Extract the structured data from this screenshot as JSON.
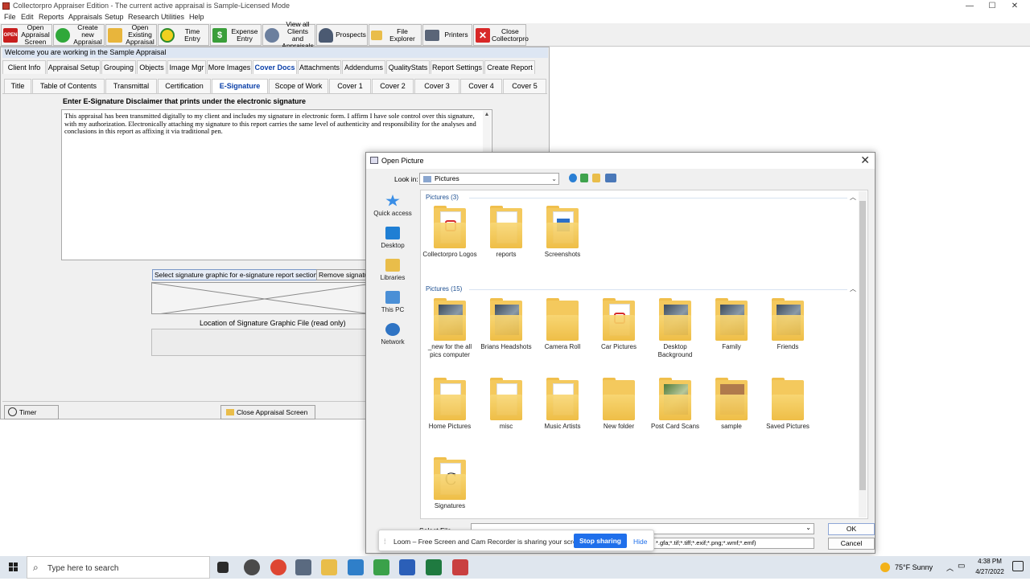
{
  "window": {
    "title": "Collectorpro Appraiser Edition  - The current active appraisal is Sample-Licensed Mode",
    "controls": [
      "—",
      "☐",
      "✕"
    ]
  },
  "menu": [
    "File",
    "Edit",
    "Reports",
    "Appraisals",
    "Setup",
    "Research",
    "Utilities",
    "Help"
  ],
  "toolbar": {
    "buttons": [
      {
        "label": "Open\nAppraisal\nScreen",
        "icon": "open-icon"
      },
      {
        "label": "Create new\nAppraisal",
        "icon": "add-icon"
      },
      {
        "label": "Open\nExisting\nAppraisal",
        "icon": "folder-open-icon"
      },
      {
        "label": "Time Entry",
        "icon": "clock-icon"
      },
      {
        "label": "Expense\nEntry",
        "icon": "dollar-icon"
      },
      {
        "label": "View all\nClients and\nAppraisals",
        "icon": "people-icon"
      },
      {
        "label": "Prospects",
        "icon": "person-icon"
      },
      {
        "label": "File Explorer",
        "icon": "folder-icon"
      },
      {
        "label": "Printers",
        "icon": "printer-icon"
      },
      {
        "label": "Close\nCollectorpro",
        "icon": "close-icon"
      }
    ]
  },
  "welcome": "Welcome  you are working in the  Sample Appraisal",
  "tabs_main": [
    "Client Info",
    "Appraisal Setup",
    "Grouping",
    "Objects",
    "Image Mgr",
    "More Images",
    "Cover Docs",
    "Attachments",
    "Addendums",
    "QualityStats",
    "Report Settings",
    "Create Report"
  ],
  "tabs_main_active": "Cover Docs",
  "tabs_sub": [
    "Title",
    "Table of Contents",
    "Transmittal",
    "Certification",
    "E-Signature",
    "Scope of Work",
    "Cover 1",
    "Cover 2",
    "Cover 3",
    "Cover 4",
    "Cover 5"
  ],
  "tabs_sub_active": "E-Signature",
  "esig": {
    "heading": "Enter E-Signature Disclaimer that prints under the electronic signature",
    "disclaimer": "This appraisal has been transmitted digitally to my client and includes my signature in electronic form. I affirm I have sole control over this signature, with my authorization.  Electronically attaching my signature to this report carries the same level of authenticity and responsibility for the analyses and conclusions in this report as affixing it via traditional pen.",
    "select_button": "Select signature graphic for e-signature report section",
    "remove_button": "Remove signatu",
    "location_label": "Location of Signature Graphic File (read only)"
  },
  "bottom": {
    "timer": "Timer",
    "close_screen": "Close Appraisal  Screen"
  },
  "dialog": {
    "title": "Open Picture",
    "lookin_label": "Look in:",
    "lookin_value": "Pictures",
    "places": [
      "Quick access",
      "Desktop",
      "Libraries",
      "This PC",
      "Network"
    ],
    "group1": "Pictures (3)",
    "group2": "Pictures (15)",
    "items1": [
      {
        "name": "Collectorpro Logos",
        "kind": "pdf"
      },
      {
        "name": "reports",
        "kind": "paper"
      },
      {
        "name": "Screenshots",
        "kind": "blue"
      }
    ],
    "items2": [
      {
        "name": "_new for the all pics computer",
        "kind": "photo"
      },
      {
        "name": "Brians Headshots",
        "kind": "photo"
      },
      {
        "name": "Camera Roll",
        "kind": "empty"
      },
      {
        "name": "Car Pictures",
        "kind": "pdf"
      },
      {
        "name": "Desktop Background",
        "kind": "photo"
      },
      {
        "name": "Family",
        "kind": "photo"
      },
      {
        "name": "Friends",
        "kind": "photo"
      },
      {
        "name": "Home Pictures",
        "kind": "paper"
      },
      {
        "name": "misc",
        "kind": "paper"
      },
      {
        "name": "Music Artists",
        "kind": "paper"
      },
      {
        "name": "New folder",
        "kind": "empty"
      },
      {
        "name": "Post Card Scans",
        "kind": "green"
      },
      {
        "name": "sample",
        "kind": "brown"
      },
      {
        "name": "Saved Pictures",
        "kind": "empty"
      },
      {
        "name": "Signatures",
        "kind": "sig"
      }
    ],
    "select_file_label": "Select File",
    "filter_value": "*.gfa;*.tif;*.tiff;*.exif;*.png;*.wmf;*.emf)",
    "ok": "OK",
    "cancel": "Cancel"
  },
  "loom": {
    "message": "Loom – Free Screen and Cam Recorder is sharing your screen.",
    "stop": "Stop sharing",
    "hide": "Hide"
  },
  "taskbar": {
    "search_placeholder": "Type here to search",
    "weather": "75°F  Sunny",
    "time": "4:38 PM",
    "date": "4/27/2022"
  },
  "colors": {
    "accent": "#1f6feb",
    "tab_active_text": "#0a3fa8",
    "folder": "#f4c95d",
    "welcome_bg": "#dde6f3"
  }
}
